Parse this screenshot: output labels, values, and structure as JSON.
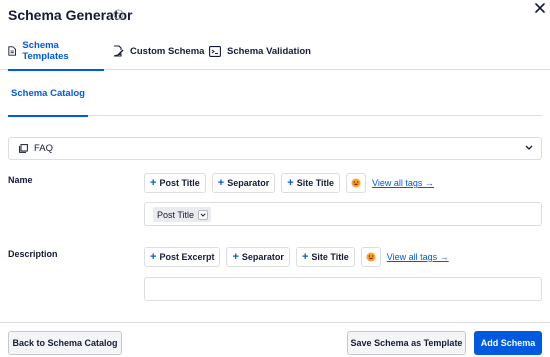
{
  "header": {
    "title": "Schema Generator"
  },
  "tabs": [
    {
      "label": "Schema Templates",
      "icon": "document-icon",
      "active": true
    },
    {
      "label": "Custom Schema",
      "icon": "edit-document-icon",
      "active": false
    },
    {
      "label": "Schema Validation",
      "icon": "terminal-icon",
      "active": false
    }
  ],
  "subtabs": [
    {
      "label": "Schema Catalog",
      "active": true
    }
  ],
  "catalog_select": {
    "value": "FAQ"
  },
  "fields": {
    "name": {
      "label": "Name",
      "tags": [
        "Post Title",
        "Separator",
        "Site Title"
      ],
      "view_all": "View all tags →",
      "chip": "Post Title"
    },
    "description": {
      "label": "Description",
      "tags": [
        "Post Excerpt",
        "Separator",
        "Site Title"
      ],
      "view_all": "View all tags →"
    }
  },
  "footer": {
    "back_label": "Back to Schema Catalog",
    "save_label": "Save Schema as Template",
    "add_label": "Add Schema"
  },
  "colors": {
    "accent": "#005ae0",
    "text": "#141b38",
    "border": "#dcdde1"
  }
}
